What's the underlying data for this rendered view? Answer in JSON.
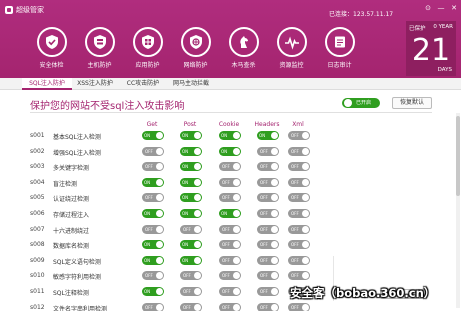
{
  "app": {
    "title": "超级管家"
  },
  "header": {
    "ip_label": "已连接：123.57.11.17",
    "window_buttons": [
      "⊙",
      "—",
      "✕"
    ]
  },
  "nav": [
    {
      "label": "安全体检",
      "icon": "shield-check-icon"
    },
    {
      "label": "主机防护",
      "icon": "server-icon"
    },
    {
      "label": "应用防护",
      "icon": "app-shield-icon"
    },
    {
      "label": "网络防护",
      "icon": "network-shield-icon"
    },
    {
      "label": "木马查杀",
      "icon": "horse-icon"
    },
    {
      "label": "资源监控",
      "icon": "heartbeat-icon"
    },
    {
      "label": "日志审计",
      "icon": "log-icon"
    }
  ],
  "date_box": {
    "top_left": "已保护",
    "top_right": "0 YEAR",
    "number": "21",
    "unit": "DAYS"
  },
  "tabs": [
    "SQL注入防护",
    "XSS注入防护",
    "CC攻击防护",
    "网马主动拦截"
  ],
  "page": {
    "title": "保护您的网站不受sql注入攻击影响",
    "master_toggle_label": "已开启",
    "restore_button": "恢复默认"
  },
  "columns": [
    "Get",
    "Post",
    "Cookie",
    "Headers",
    "Xml"
  ],
  "toggle_labels": {
    "on": "ON",
    "off": "OFF"
  },
  "rules": [
    {
      "id": "s001",
      "name": "基本SQL注入检测",
      "states": [
        1,
        1,
        1,
        1,
        0
      ]
    },
    {
      "id": "s002",
      "name": "增强SQL注入检测",
      "states": [
        0,
        1,
        1,
        0,
        0
      ]
    },
    {
      "id": "s003",
      "name": "多关键字检测",
      "states": [
        0,
        1,
        0,
        0,
        0
      ]
    },
    {
      "id": "s004",
      "name": "盲注检测",
      "states": [
        1,
        1,
        0,
        0,
        0
      ]
    },
    {
      "id": "s005",
      "name": "认证绕过检测",
      "states": [
        0,
        1,
        0,
        0,
        0
      ]
    },
    {
      "id": "s006",
      "name": "存储过程注入",
      "states": [
        1,
        1,
        1,
        0,
        0
      ]
    },
    {
      "id": "s007",
      "name": "十六进制绕过",
      "states": [
        0,
        0,
        0,
        0,
        0
      ]
    },
    {
      "id": "s008",
      "name": "数据库名检测",
      "states": [
        1,
        1,
        0,
        0,
        0
      ]
    },
    {
      "id": "s009",
      "name": "SQL定义语句检测",
      "states": [
        1,
        1,
        0,
        0,
        0
      ]
    },
    {
      "id": "s010",
      "name": "敏感字符利用检测",
      "states": [
        0,
        0,
        0,
        0,
        0
      ]
    },
    {
      "id": "s011",
      "name": "SQL注释检测",
      "states": [
        1,
        0,
        0,
        0,
        0
      ]
    },
    {
      "id": "s012",
      "name": "文件名字串利用检测",
      "states": [
        0,
        0,
        0,
        0,
        0
      ]
    }
  ],
  "watermark": "安全客（bobao.360.cn）",
  "colors": {
    "brand": "#a4246f",
    "on": "#2f9e1f",
    "off": "#999999"
  }
}
